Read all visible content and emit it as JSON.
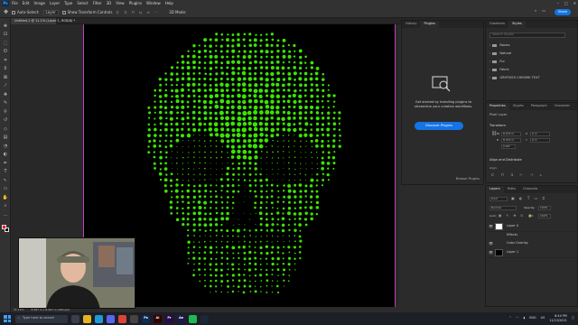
{
  "menubar": {
    "logo": "Ps",
    "items": [
      "File",
      "Edit",
      "Image",
      "Layer",
      "Type",
      "Select",
      "Filter",
      "3D",
      "View",
      "Plugins",
      "Window",
      "Help"
    ],
    "window_controls": [
      "–",
      "□",
      "✕"
    ]
  },
  "optionsbar": {
    "auto_select_label": "Auto-Select:",
    "auto_select_target": "Layer",
    "show_transform_label": "Show Transform Controls",
    "share_label": "Share",
    "mode_3d_label": "3D Mode:"
  },
  "document": {
    "tab_title": "Untitled-1 @ 11.1% (Layer 1, RGB/8) *"
  },
  "toolbar": {
    "icons": [
      "move-icon",
      "artboard-icon",
      "marquee-icon",
      "lasso-icon",
      "object-select-icon",
      "crop-icon",
      "frame-icon",
      "eyedropper-icon",
      "healing-brush-icon",
      "brush-icon",
      "clone-stamp-icon",
      "history-brush-icon",
      "eraser-icon",
      "gradient-icon",
      "blur-icon",
      "dodge-icon",
      "pen-icon",
      "type-icon",
      "path-select-icon",
      "rectangle-icon",
      "hand-icon",
      "zoom-icon",
      "more-tools-icon"
    ],
    "glyphs": [
      "✥",
      "⊡",
      "⬚",
      "ʘ",
      "⌗",
      "⌷",
      "⊠",
      "⁄",
      "✚",
      "✎",
      "⚲",
      "↺",
      "◇",
      "▤",
      "◔",
      "◐",
      "✒",
      "T",
      "↖",
      "▭",
      "✋",
      "⌕",
      "…"
    ],
    "foreground_color": "#ff0000",
    "background_color": "#000000"
  },
  "statusbar": {
    "zoom": "11.11%",
    "doc_info": "8.467 in x 8.467 in (300 ppi)"
  },
  "plugins_panel": {
    "tabs": [
      "History",
      "Plugins"
    ],
    "active_tab": 1,
    "message": "Get started by installing plugins to streamline your creative workflows.",
    "discover_button": "Discover Plugins",
    "browse_link": "Browse Plugins"
  },
  "styles_panel": {
    "tabs": [
      "Gradients",
      "Styles"
    ],
    "active_tab": 1,
    "search_placeholder": "Search Styles",
    "folders": [
      "Basics",
      "Natural",
      "Fur",
      "Fabric",
      "GRYFON'S CHROME TEXT"
    ]
  },
  "properties_panel": {
    "tabs": [
      "Properties",
      "Glyphs",
      "Paragraph",
      "Character"
    ],
    "layer_type": "Pixel Layer",
    "transform_title": "Transform",
    "w_label": "W",
    "w_value": "8.472 in",
    "h_label": "H",
    "h_value": "8.471 in",
    "x_label": "X",
    "x_value": "0 in",
    "y_label": "Y",
    "y_value": "0 in",
    "angle_value": "0.00°",
    "align_title": "Align and Distribute",
    "align_sub": "Align:"
  },
  "layers_panel": {
    "tabs": [
      "Layers",
      "Paths",
      "Channels"
    ],
    "kind_filter": "Kind",
    "blend_mode": "Normal",
    "opacity_label": "Opacity:",
    "opacity_value": "100%",
    "lock_label": "Lock:",
    "fill_label": "Fill:",
    "fill_value": "100%",
    "layers": [
      {
        "name": "Layer 0",
        "thumb": "white",
        "sub": false
      },
      {
        "name": "Effects",
        "thumb": "none",
        "sub": true
      },
      {
        "name": "Color Overlay",
        "thumb": "none",
        "sub": true
      },
      {
        "name": "Layer 1",
        "thumb": "black",
        "sub": false
      }
    ]
  },
  "taskbar": {
    "search_placeholder": "Type here to search",
    "apps": [
      {
        "name": "task-view-app",
        "label": "",
        "color": "#3a3f4a"
      },
      {
        "name": "explorer-app",
        "label": "",
        "color": "#e6b422"
      },
      {
        "name": "edge-app",
        "label": "",
        "color": "#1c9bd6"
      },
      {
        "name": "discord-app",
        "label": "",
        "color": "#5865f2"
      },
      {
        "name": "chrome-app",
        "label": "",
        "color": "#db4437"
      },
      {
        "name": "obs-app",
        "label": "",
        "color": "#444"
      },
      {
        "name": "photoshop-app",
        "label": "Ps",
        "color": "#0f2b57"
      },
      {
        "name": "illustrator-app",
        "label": "Ai",
        "color": "#330000"
      },
      {
        "name": "premiere-app",
        "label": "Pr",
        "color": "#2a0a4a"
      },
      {
        "name": "aftereffects-app",
        "label": "Ae",
        "color": "#1a1a4a"
      },
      {
        "name": "spotify-app",
        "label": "",
        "color": "#1db954"
      },
      {
        "name": "steam-app",
        "label": "",
        "color": "#1b2838"
      }
    ],
    "tray_lang": "ENG",
    "tray_region": "US",
    "time": "8:44 PM",
    "date": "11/12/2021"
  },
  "colors": {
    "accent": "#1473e6",
    "skull_green": "#39e600",
    "guide": "#c040c0"
  }
}
